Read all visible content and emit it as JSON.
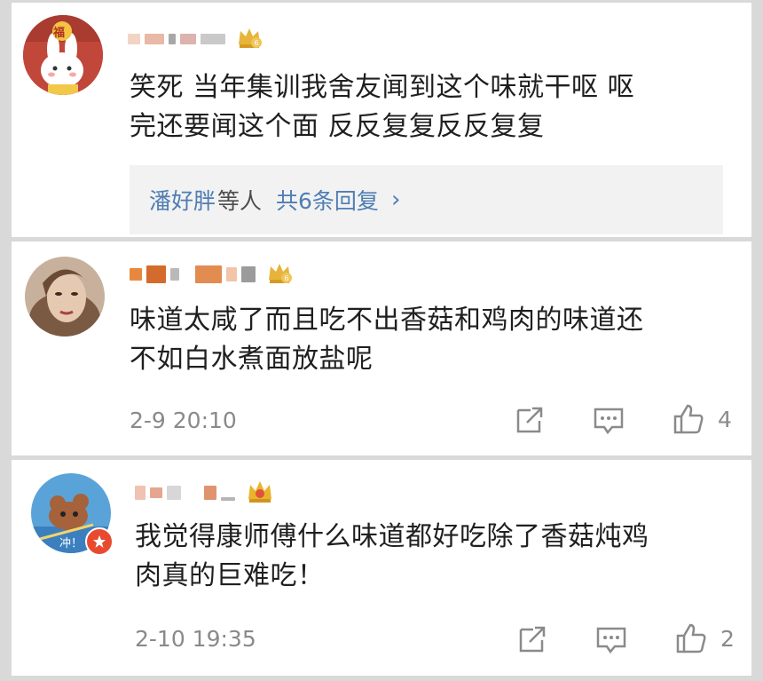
{
  "comments": [
    {
      "text_line1": "笑死 当年集训我舍友闻到这个味就干呕 呕",
      "text_line2": "完还要闻这个面 反反复复反反复复",
      "avatar_label": "福",
      "replies": {
        "name": "潘好胖",
        "rest": "等人",
        "count": "共6条回复",
        "chevron": "›"
      }
    },
    {
      "text_line1": "味道太咸了而且吃不出香菇和鸡肉的味道还",
      "text_line2": "不如白水煮面放盐呢",
      "time": "2-9 20:10",
      "likes": "4"
    },
    {
      "text_line1": "我觉得康师傅什么味道都好吃除了香菇炖鸡",
      "text_line2": "肉真的巨难吃！",
      "time": "2-10 19:35",
      "likes": "2",
      "avatar_label": "冲！"
    }
  ],
  "colors": {
    "link_blue": "#4f7db3",
    "meta_gray": "#8a8a8a",
    "badge_gold": "#e7b43a"
  },
  "icons": [
    "share-icon",
    "comment-icon",
    "like-icon",
    "chevron-right-icon",
    "member-crown-badge-icon"
  ]
}
